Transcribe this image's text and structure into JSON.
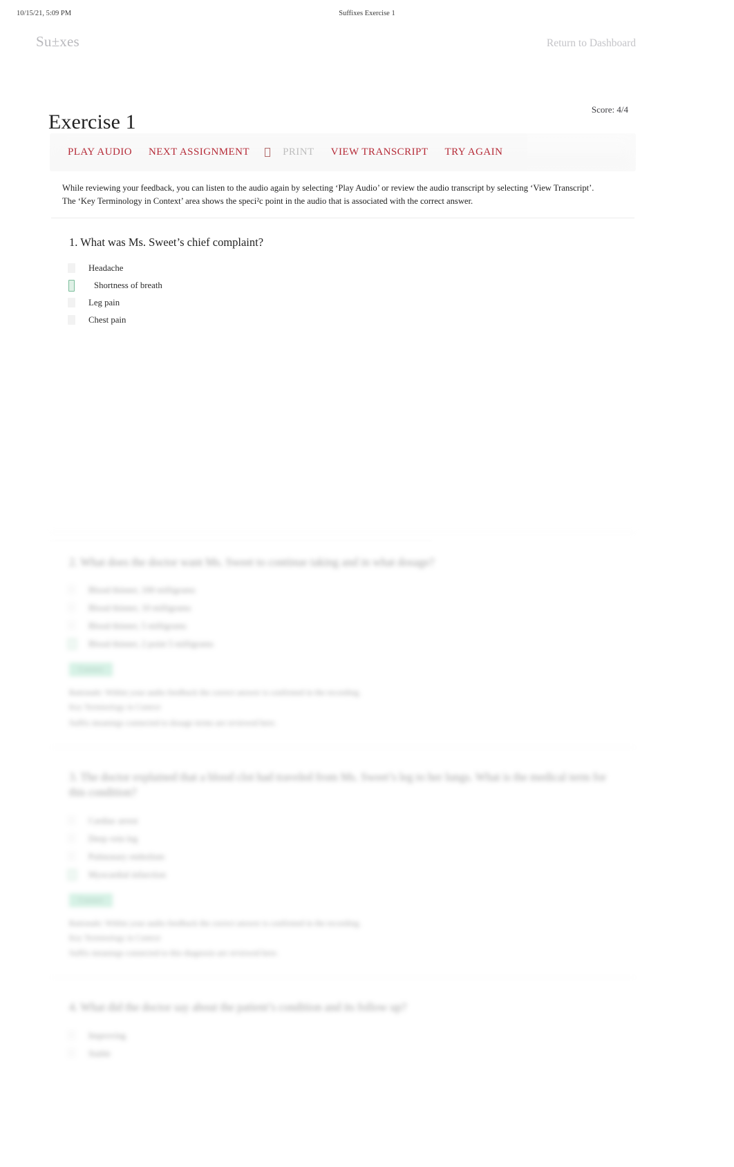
{
  "print_header": {
    "timestamp": "10/15/21, 5:09 PM",
    "document_title": "Suffixes Exercise 1"
  },
  "nav": {
    "brand": "Su±xes",
    "return_link": "Return to Dashboard"
  },
  "page": {
    "title": "Exercise 1",
    "score": "Score: 4/4"
  },
  "toolbar": {
    "play_audio": "PLAY AUDIO",
    "next_assignment": "NEXT ASSIGNMENT",
    "print": "PRINT",
    "view_transcript": "VIEW TRANSCRIPT",
    "try_again": "TRY AGAIN",
    "print_disabled": true,
    "accent_color": "#b52a37",
    "disabled_color": "#bdbdbd"
  },
  "instructions": {
    "line1": "While reviewing your feedback, you can listen to the audio again by selecting ‘Play Audio’ or review the audio transcript by selecting ‘View Transcript’.",
    "line2": "The ‘Key Terminology in Context’ area shows the speci²c point in the audio that is associated with the correct answer."
  },
  "questions": [
    {
      "number": "1.",
      "text": "What was Ms. Sweet’s chief complaint?",
      "options": [
        {
          "label": "Headache",
          "correct": false
        },
        {
          "label": "Shortness of breath",
          "correct": true
        },
        {
          "label": "Leg pain",
          "correct": false
        },
        {
          "label": "Chest pain",
          "correct": false
        }
      ]
    }
  ],
  "blurred_questions": [
    {
      "number": "2.",
      "text": "What does the doctor want Ms. Sweet to continue taking and in what dosage?",
      "options": [
        {
          "label": "Blood thinner, 100 milligrams",
          "correct": false
        },
        {
          "label": "Blood thinner, 10 milligrams",
          "correct": false
        },
        {
          "label": "Blood thinner, 5 milligrams",
          "correct": false
        },
        {
          "label": "Blood thinner, 2 point 5 milligrams",
          "correct": true
        }
      ],
      "badge": "Correct",
      "feedback_rows": [
        "Rationale: Within your audio feedback the correct answer is confirmed in the recording.",
        "Key Terminology in Context",
        "Suffix meanings connected to dosage terms are reviewed here."
      ]
    },
    {
      "number": "3.",
      "text": "The doctor explained that a blood clot had traveled from Ms. Sweet’s leg to her lungs. What is the medical term for this condition?",
      "options": [
        {
          "label": "Cardiac arrest",
          "correct": false
        },
        {
          "label": "Deep vein leg",
          "correct": false
        },
        {
          "label": "Pulmonary embolism",
          "correct": true
        },
        {
          "label": "Myocardial infarction",
          "correct": false
        }
      ],
      "badge": "Correct",
      "feedback_rows": [
        "Rationale: Within your audio feedback the correct answer is confirmed in the recording.",
        "Key Terminology in Context",
        "Suffix meanings connected to this diagnosis are reviewed here."
      ]
    },
    {
      "number": "4.",
      "text": "What did the doctor say about the patient’s condition and its follow up?",
      "options": [
        {
          "label": "Improving",
          "correct": false
        },
        {
          "label": "Stable",
          "correct": false
        }
      ],
      "badge": "",
      "feedback_rows": []
    }
  ],
  "colors": {
    "accent_red": "#b52a37",
    "correct_green": "#9fe0c4",
    "muted_grey": "#bdbdbd",
    "page_bg": "#ffffff"
  }
}
